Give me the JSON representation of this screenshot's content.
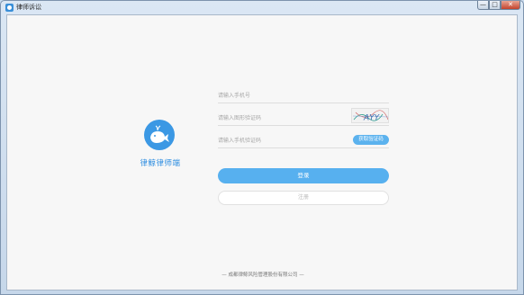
{
  "window": {
    "title": "律师诉讼",
    "controls": {
      "minimize": "—",
      "maximize": "□",
      "close": "✕"
    }
  },
  "brand": {
    "name": "律鲸律师端",
    "logo_icon": "whale-icon",
    "accent_color": "#2b8ce0"
  },
  "form": {
    "phone_placeholder": "请输入手机号",
    "captcha_placeholder": "请输入图形验证码",
    "captcha_image_text": "AYY",
    "sms_placeholder": "请输入手机验证码",
    "sms_button": "获取验证码",
    "login_button": "登录",
    "register_button": "注册"
  },
  "footer": {
    "copyright": "— 成都律鲸风险管理股份有限公司 —"
  }
}
